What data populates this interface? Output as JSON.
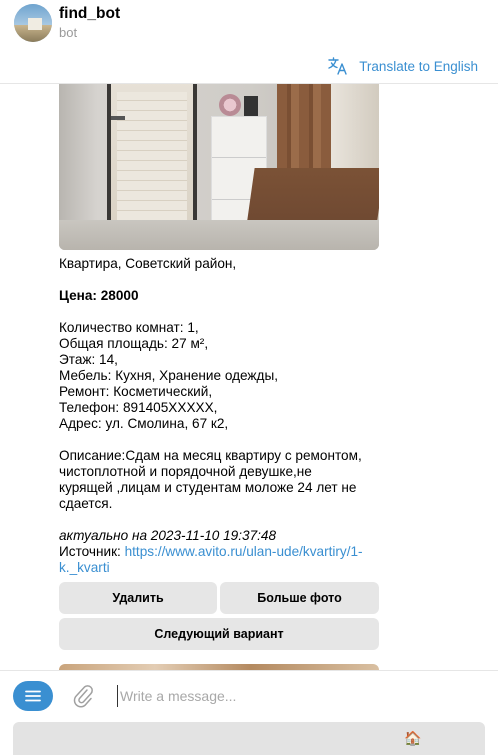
{
  "header": {
    "title": "find_bot",
    "subtitle": "bot",
    "translate_label": "Translate to English"
  },
  "message": {
    "line_district": "Квартира, Советский район,",
    "price": "Цена: 28000",
    "rooms": "Количество комнат: 1,",
    "area": "Общая площадь: 27 м²,",
    "floor": "Этаж: 14,",
    "furniture": "Мебель: Кухня, Хранение одежды,",
    "renovation": "Ремонт: Косметический,",
    "phone": "Телефон: 891405XXXXX,",
    "address": "Адрес: ул. Смолина, 67 к2,",
    "desc_1": "Описание:Сдам на месяц квартиру с ремонтом,",
    "desc_2": "чистоплотной и порядочной девушке,не",
    "desc_3": "курящей ,лицам и студентам моложе 24 лет не",
    "desc_4": "сдается.",
    "actual": "актуально на 2023-11-10 19:37:48",
    "source_label": "Источник: ",
    "source_link_1": "https://www.avito.ru/ulan-ude/kvartiry/1-",
    "source_link_2": "k._kvarti"
  },
  "buttons": {
    "delete": "Удалить",
    "more_photos": "Больше фото",
    "next_option": "Следующий вариант"
  },
  "compose": {
    "placeholder": "Write a message..."
  },
  "keyboard": {
    "key_label": "🏠"
  },
  "colors": {
    "accent": "#3a8fd1",
    "button_bg": "#e6e6e6",
    "muted_text": "#9a9a9a"
  }
}
